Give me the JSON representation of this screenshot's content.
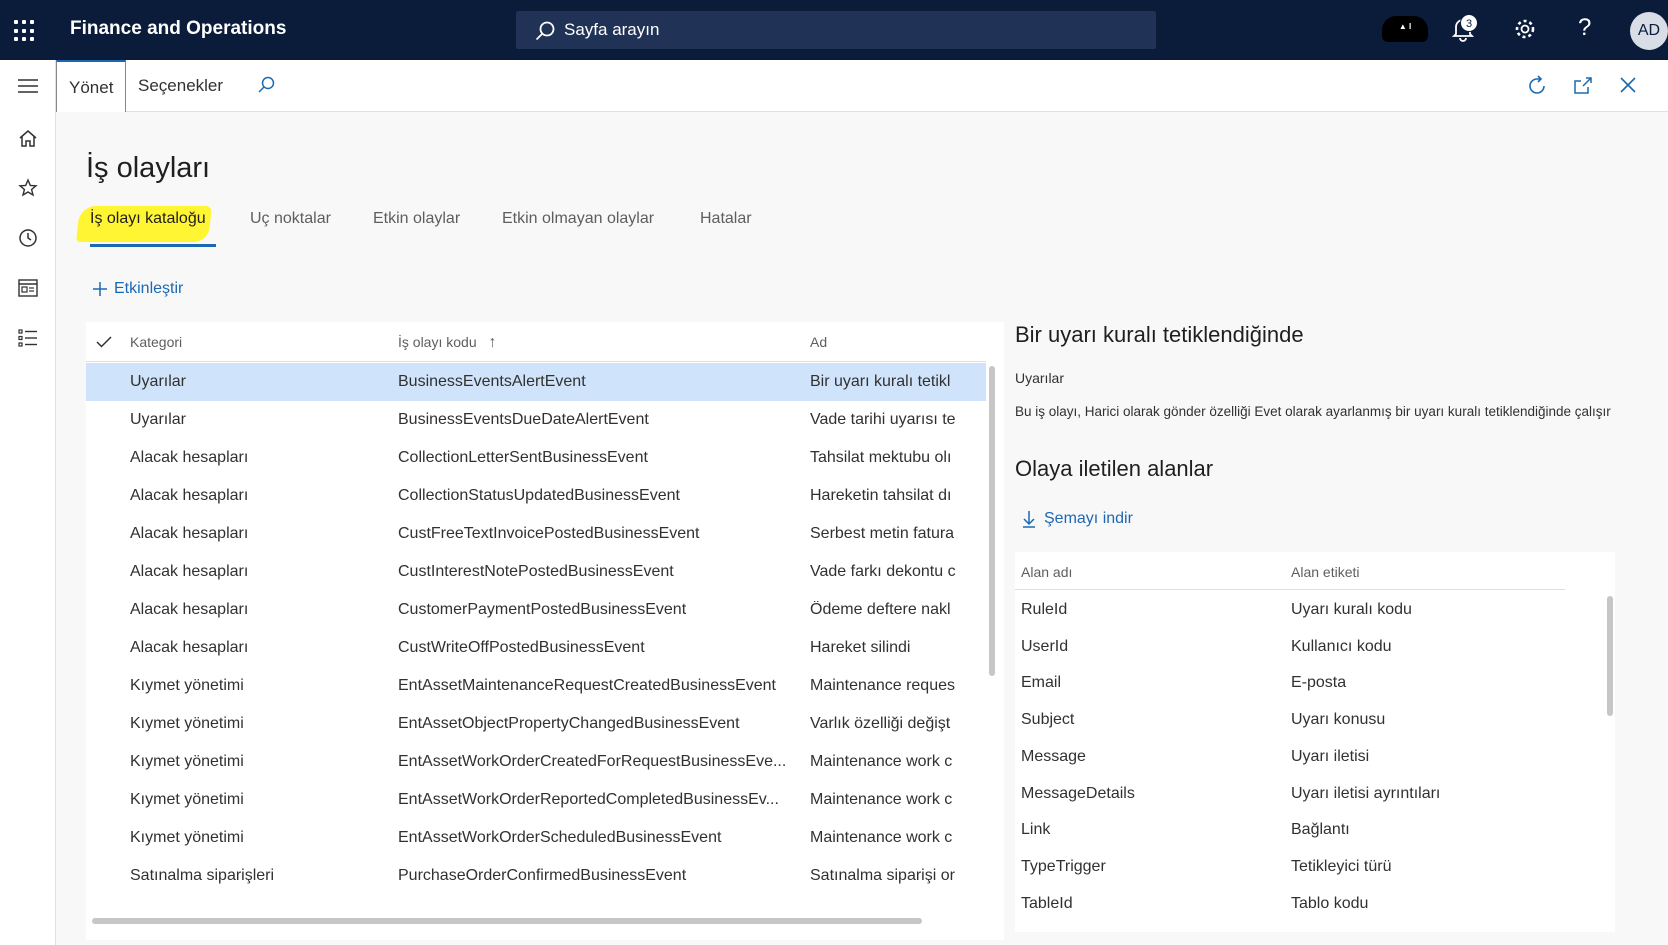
{
  "topbar": {
    "app_title": "Finance and Operations",
    "search_placeholder": "Sayfa arayın",
    "notification_count": "3",
    "help_label": "?",
    "avatar_initials": "AD"
  },
  "actionbar": {
    "tabs": [
      {
        "label": "Yönet"
      },
      {
        "label": "Seçenekler"
      }
    ]
  },
  "page": {
    "title": "İş olayları",
    "tabs": [
      {
        "label": "İş olayı kataloğu"
      },
      {
        "label": "Uç noktalar"
      },
      {
        "label": "Etkin olaylar"
      },
      {
        "label": "Etkin olmayan olaylar"
      },
      {
        "label": "Hatalar"
      }
    ],
    "activate_label": "Etkinleştir"
  },
  "grid": {
    "columns": [
      "Kategori",
      "İş olayı kodu",
      "Ad"
    ],
    "sort_indicator": "↑",
    "rows": [
      {
        "category": "Uyarılar",
        "code": "BusinessEventsAlertEvent",
        "name": "Bir uyarı kuralı tetikl"
      },
      {
        "category": "Uyarılar",
        "code": "BusinessEventsDueDateAlertEvent",
        "name": "Vade tarihi uyarısı te"
      },
      {
        "category": "Alacak hesapları",
        "code": "CollectionLetterSentBusinessEvent",
        "name": "Tahsilat mektubu olı"
      },
      {
        "category": "Alacak hesapları",
        "code": "CollectionStatusUpdatedBusinessEvent",
        "name": "Hareketin tahsilat dı"
      },
      {
        "category": "Alacak hesapları",
        "code": "CustFreeTextInvoicePostedBusinessEvent",
        "name": "Serbest metin fatura"
      },
      {
        "category": "Alacak hesapları",
        "code": "CustInterestNotePostedBusinessEvent",
        "name": "Vade farkı dekontu c"
      },
      {
        "category": "Alacak hesapları",
        "code": "CustomerPaymentPostedBusinessEvent",
        "name": "Ödeme deftere nakl"
      },
      {
        "category": "Alacak hesapları",
        "code": "CustWriteOffPostedBusinessEvent",
        "name": "Hareket silindi"
      },
      {
        "category": "Kıymet yönetimi",
        "code": "EntAssetMaintenanceRequestCreatedBusinessEvent",
        "name": "Maintenance reques"
      },
      {
        "category": "Kıymet yönetimi",
        "code": "EntAssetObjectPropertyChangedBusinessEvent",
        "name": "Varlık özelliği değişt"
      },
      {
        "category": "Kıymet yönetimi",
        "code": "EntAssetWorkOrderCreatedForRequestBusinessEve...",
        "name": "Maintenance work c"
      },
      {
        "category": "Kıymet yönetimi",
        "code": "EntAssetWorkOrderReportedCompletedBusinessEv...",
        "name": "Maintenance work c"
      },
      {
        "category": "Kıymet yönetimi",
        "code": "EntAssetWorkOrderScheduledBusinessEvent",
        "name": "Maintenance work c"
      },
      {
        "category": "Satınalma siparişleri",
        "code": "PurchaseOrderConfirmedBusinessEvent",
        "name": "Satınalma siparişi or"
      }
    ]
  },
  "detail": {
    "title": "Bir uyarı kuralı tetiklendiğinde",
    "category": "Uyarılar",
    "description": "Bu iş olayı, Harici olarak gönder özelliği Evet olarak ayarlanmış bir uyarı kuralı tetiklendiğinde çalışır",
    "fields_title": "Olaya iletilen alanlar",
    "download_label": "Şemayı indir",
    "field_columns": [
      "Alan adı",
      "Alan etiketi"
    ],
    "fields": [
      {
        "name": "RuleId",
        "label": "Uyarı kuralı kodu"
      },
      {
        "name": "UserId",
        "label": "Kullanıcı kodu"
      },
      {
        "name": "Email",
        "label": "E-posta"
      },
      {
        "name": "Subject",
        "label": "Uyarı konusu"
      },
      {
        "name": "Message",
        "label": "Uyarı iletisi"
      },
      {
        "name": "MessageDetails",
        "label": "Uyarı iletisi ayrıntıları"
      },
      {
        "name": "Link",
        "label": "Bağlantı"
      },
      {
        "name": "TypeTrigger",
        "label": "Tetikleyici türü"
      },
      {
        "name": "TableId",
        "label": "Tablo kodu"
      }
    ]
  },
  "colors": {
    "topbar_bg": "#0b1c3b",
    "accent": "#1c68b3",
    "selected_row": "#cfe4fa",
    "highlight": "#fff533"
  }
}
